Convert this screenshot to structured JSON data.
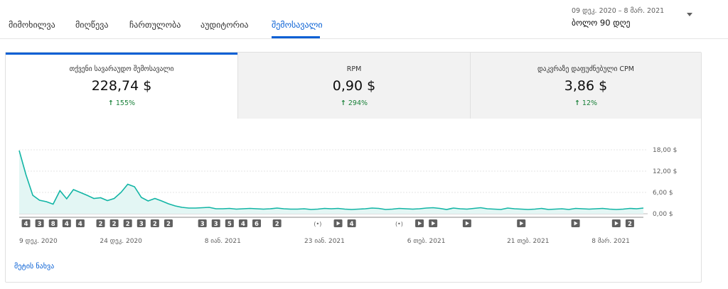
{
  "tabs": [
    {
      "label": "მიმოხილვა",
      "active": false
    },
    {
      "label": "მიღწევა",
      "active": false
    },
    {
      "label": "ჩართულობა",
      "active": false
    },
    {
      "label": "აუდიტორია",
      "active": false
    },
    {
      "label": "შემოსავალი",
      "active": true
    }
  ],
  "date_range": {
    "range": "09 დეკ. 2020 – 8 მარ. 2021",
    "label": "ბოლო 90 დღე"
  },
  "metrics": [
    {
      "label": "თქვენი სავარაუდო შემოსავალი",
      "value": "228,74 $",
      "change": "155%",
      "active": true
    },
    {
      "label": "RPM",
      "value": "0,90 $",
      "change": "294%",
      "active": false
    },
    {
      "label": "დაკვრაზე დაფუძნებული CPM",
      "value": "3,86 $",
      "change": "12%",
      "active": false
    }
  ],
  "more_link": "მეტის ნახვა",
  "colors": {
    "accent": "#065fd4",
    "line": "#12b5a5",
    "fill": "#e3f6f4",
    "positive": "#188038"
  },
  "chart_data": {
    "type": "area",
    "y_ticks": [
      "18,00 $",
      "12,00 $",
      "6,00 $",
      "0,00 $"
    ],
    "ylim": [
      0,
      18
    ],
    "x_tick_labels": [
      "9 დეკ. 2020",
      "24 დეკ. 2020",
      "8 იან. 2021",
      "23 იან. 2021",
      "6 თებ. 2021",
      "21 თებ. 2021",
      "8 მარ. 2021"
    ],
    "values": [
      17.8,
      11,
      5.2,
      3.8,
      3.4,
      2.7,
      6.5,
      4.2,
      6.8,
      6,
      5.2,
      4.3,
      4.5,
      3.7,
      4.3,
      6,
      8.3,
      7.6,
      4.6,
      3.6,
      4.3,
      3.6,
      2.8,
      2.2,
      1.8,
      1.6,
      1.6,
      1.7,
      1.8,
      1.4,
      1.4,
      1.5,
      1.3,
      1.4,
      1.5,
      1.4,
      1.3,
      1.4,
      1.6,
      1.4,
      1.3,
      1.3,
      1.4,
      1.2,
      1.3,
      1.5,
      1.4,
      1.5,
      1.3,
      1.2,
      1.3,
      1.4,
      1.6,
      1.5,
      1.2,
      1.3,
      1.5,
      1.4,
      1.3,
      1.4,
      1.6,
      1.7,
      1.5,
      1.2,
      1.6,
      1.4,
      1.3,
      1.5,
      1.7,
      1.4,
      1.3,
      1.2,
      1.6,
      1.4,
      1.3,
      1.2,
      1.3,
      1.5,
      1.2,
      1.3,
      1.4,
      1.2,
      1.5,
      1.4,
      1.3,
      1.4,
      1.5,
      1.3,
      1.2,
      1.3,
      1.5,
      1.4,
      1.6
    ],
    "markers": [
      {
        "type": "num",
        "label": "4",
        "day": 1
      },
      {
        "type": "num",
        "label": "3",
        "day": 3
      },
      {
        "type": "num",
        "label": "8",
        "day": 5
      },
      {
        "type": "num",
        "label": "4",
        "day": 7
      },
      {
        "type": "num",
        "label": "4",
        "day": 9
      },
      {
        "type": "num",
        "label": "2",
        "day": 12
      },
      {
        "type": "num",
        "label": "2",
        "day": 14
      },
      {
        "type": "num",
        "label": "2",
        "day": 16
      },
      {
        "type": "num",
        "label": "3",
        "day": 18
      },
      {
        "type": "num",
        "label": "2",
        "day": 20
      },
      {
        "type": "num",
        "label": "2",
        "day": 22
      },
      {
        "type": "num",
        "label": "3",
        "day": 27
      },
      {
        "type": "num",
        "label": "3",
        "day": 29
      },
      {
        "type": "num",
        "label": "5",
        "day": 31
      },
      {
        "type": "num",
        "label": "4",
        "day": 33
      },
      {
        "type": "num",
        "label": "6",
        "day": 35
      },
      {
        "type": "num",
        "label": "2",
        "day": 38
      },
      {
        "type": "live",
        "label": "(•)",
        "day": 44
      },
      {
        "type": "play",
        "label": "",
        "day": 47
      },
      {
        "type": "num",
        "label": "4",
        "day": 49
      },
      {
        "type": "live",
        "label": "(•)",
        "day": 56
      },
      {
        "type": "play",
        "label": "",
        "day": 59
      },
      {
        "type": "play",
        "label": "",
        "day": 61
      },
      {
        "type": "play",
        "label": "",
        "day": 66
      },
      {
        "type": "play",
        "label": "",
        "day": 74
      },
      {
        "type": "play",
        "label": "",
        "day": 82
      },
      {
        "type": "play",
        "label": "",
        "day": 88
      },
      {
        "type": "num",
        "label": "2",
        "day": 90
      }
    ]
  }
}
